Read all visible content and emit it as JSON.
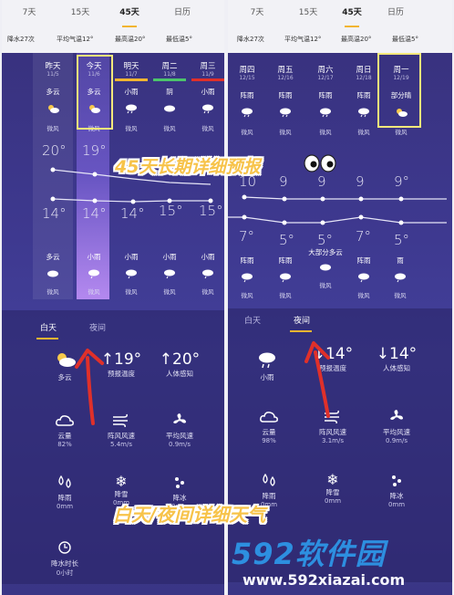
{
  "left": {
    "tabs": [
      "7天",
      "15天",
      "45天",
      "日历"
    ],
    "stats": [
      "降水27次",
      "平均气温12°",
      "最高温20°",
      "最低温5°"
    ],
    "days": [
      {
        "name": "昨天",
        "date": "11/5",
        "cond": "多云",
        "wind": "微风",
        "hi": "20°",
        "lo": "14°",
        "cond2": "多云",
        "wind2": "微风"
      },
      {
        "name": "今天",
        "date": "11/6",
        "cond": "多云",
        "wind": "微风",
        "hi": "19°",
        "lo": "14°",
        "cond2": "小雨",
        "wind2": "微风"
      },
      {
        "name": "明天",
        "date": "11/7",
        "cond": "小雨",
        "wind": "微风",
        "hi": "",
        "lo": "14°",
        "cond2": "小雨",
        "wind2": "微风"
      },
      {
        "name": "周二",
        "date": "11/8",
        "cond": "阴",
        "wind": "微风",
        "hi": "",
        "lo": "15°",
        "cond2": "小雨",
        "wind2": "微风"
      },
      {
        "name": "周三",
        "date": "11/9",
        "cond": "小雨",
        "wind": "微风",
        "hi": "",
        "lo": "15°",
        "cond2": "小雨",
        "wind2": "微风"
      }
    ],
    "subtabs": [
      "白天",
      "夜间"
    ],
    "metrics_row1": [
      {
        "big": "",
        "label": "多云"
      },
      {
        "big": "↑19°",
        "label": "预报温度"
      },
      {
        "big": "↑20°",
        "label": "人体感知"
      }
    ],
    "metrics_row2": [
      {
        "label": "云量",
        "value": "82%"
      },
      {
        "label": "阵风风速",
        "value": "5.4m/s"
      },
      {
        "label": "平均风速",
        "value": "0.9m/s"
      }
    ],
    "metrics_row3": [
      {
        "label": "降雨",
        "value": "0mm"
      },
      {
        "label": "降雪",
        "value": "0mm"
      },
      {
        "label": "降冰",
        "value": "0mm"
      }
    ],
    "metrics_row4": [
      {
        "label": "降水时长",
        "value": "0小时"
      }
    ]
  },
  "right": {
    "tabs": [
      "7天",
      "15天",
      "45天",
      "日历"
    ],
    "stats": [
      "降水27次",
      "平均气温12°",
      "最高温20°",
      "最低温5°"
    ],
    "days": [
      {
        "name": "周四",
        "date": "12/15",
        "cond": "阵雨",
        "wind": "微风",
        "hi": "10",
        "lo": "7°",
        "cond2": "阵雨",
        "wind2": "微风"
      },
      {
        "name": "周五",
        "date": "12/16",
        "cond": "阵雨",
        "wind": "微风",
        "hi": "9",
        "lo": "5°",
        "cond2": "阵雨",
        "wind2": "微风"
      },
      {
        "name": "周六",
        "date": "12/17",
        "cond": "阵雨",
        "wind": "微风",
        "hi": "9",
        "lo": "5°",
        "cond2": "大部分多云",
        "wind2": "微风"
      },
      {
        "name": "周日",
        "date": "12/18",
        "cond": "阵雨",
        "wind": "微风",
        "hi": "9",
        "lo": "7°",
        "cond2": "阵雨",
        "wind2": "微风"
      },
      {
        "name": "周一",
        "date": "12/19",
        "cond": "部分晴",
        "wind": "微风",
        "hi": "9°",
        "lo": "5°",
        "cond2": "雨",
        "wind2": "微风"
      }
    ],
    "subtabs": [
      "白天",
      "夜间"
    ],
    "metrics_row1": [
      {
        "big": "",
        "label": "小雨"
      },
      {
        "big": "↓14°",
        "label": "预报温度"
      },
      {
        "big": "↓14°",
        "label": "人体感知"
      }
    ],
    "metrics_row2": [
      {
        "label": "云量",
        "value": "98%"
      },
      {
        "label": "阵风风速",
        "value": "3.1m/s"
      },
      {
        "label": "平均风速",
        "value": "0.9m/s"
      }
    ],
    "metrics_row3": [
      {
        "label": "降雨",
        "value": "0mm"
      },
      {
        "label": "降雪",
        "value": "0mm"
      },
      {
        "label": "降冰",
        "value": "0mm"
      }
    ]
  },
  "overlay": {
    "top_caption": "45天长期详细预报",
    "bottom_caption": "白天/夜间详细天气"
  },
  "watermark": {
    "logo": "592软件园",
    "url": "www.592xiazai.com"
  },
  "colors": {
    "accent": "#f2b531",
    "highlight_box": "#f4e87b",
    "arrow": "#e0302a",
    "panel_bg": "#3e3990"
  }
}
